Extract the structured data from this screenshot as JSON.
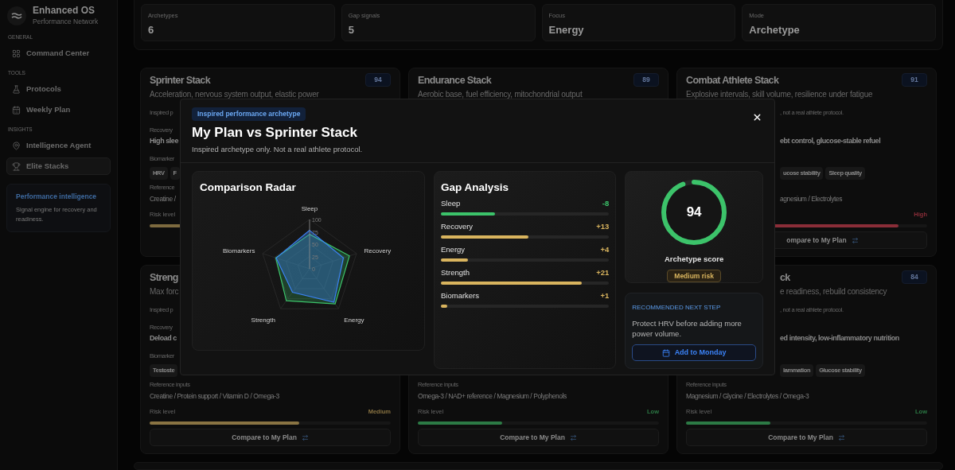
{
  "sidebar": {
    "brand": {
      "name": "Enhanced OS",
      "tagline": "Performance Network"
    },
    "sections": [
      {
        "label": "GENERAL",
        "items": [
          {
            "label": "Command Center",
            "selected": false
          }
        ]
      },
      {
        "label": "TOOLS",
        "items": [
          {
            "label": "Protocols",
            "selected": false
          },
          {
            "label": "Weekly Plan",
            "selected": false
          }
        ]
      },
      {
        "label": "INSIGHTS",
        "items": [
          {
            "label": "Intelligence Agent",
            "selected": false
          },
          {
            "label": "Elite Stacks",
            "selected": true
          }
        ]
      }
    ],
    "promo": {
      "title": "Performance intelligence",
      "text": "Signal engine for recovery and readiness."
    }
  },
  "stats": [
    {
      "label": "Archetypes",
      "value": "6"
    },
    {
      "label": "Gap signals",
      "value": "5"
    },
    {
      "label": "Focus",
      "value": "Energy"
    },
    {
      "label": "Mode",
      "value": "Archetype"
    }
  ],
  "cards": [
    {
      "title": "Sprinter Stack",
      "subtitle": "Acceleration, nervous system output, elastic power",
      "score": "94",
      "note": "Inspired p",
      "recovery_label": "Recovery",
      "recovery_value": "High slee",
      "biomarkers_label": "Biomarker",
      "chips": [
        "HRV",
        "F"
      ],
      "reference_label": "Reference",
      "reference_value": "Creatine /",
      "risk_label": "Risk level",
      "risk": {
        "color": "#7d6a3f"
      }
    },
    {
      "title": "Endurance Stack",
      "subtitle": "Aerobic base, fuel efficiency, mitochondrial output",
      "score": "89"
    },
    {
      "left_covered_body": true,
      "title": "Combat Athlete Stack",
      "subtitle": "Explosive intervals, skill volume, resilience under fatigue",
      "score": "91",
      "note": ", not a real athlete protocol.",
      "recovery_value": "ebt control, glucose-stable refuel",
      "chips": [
        "ucose stability",
        "Sleep quality"
      ],
      "reference_value": "agnesium / Electrolytes",
      "risk": {
        "label": "High",
        "color": "#8a2d38",
        "level": 0.88
      },
      "button": {
        "label": "ompare to My Plan"
      }
    },
    {
      "title": "Streng",
      "subtitle": "Max forc",
      "note": "Inspired p",
      "recovery_label": "Recovery",
      "recovery_value": "Deload c",
      "biomarkers_label": "Biomarker",
      "chips": [
        "Testoste"
      ],
      "reference_label": "Reference inputs",
      "reference_value": "Creatine / Protein support / Vitamin D / Omega-3",
      "risk_label": "Risk level",
      "risk": {
        "label": "Medium",
        "color": "#8a7443",
        "level": 0.62
      },
      "button": {
        "label": "Compare to My Plan"
      }
    },
    {
      "reference_label": "Reference inputs",
      "reference_value": "Omega-3 / NAD+ reference / Magnesium / Polyphenols",
      "risk_label": "Risk level",
      "risk": {
        "label": "Low",
        "color": "#2c7a45",
        "level": 0.35
      },
      "button": {
        "label": "Compare to My Plan"
      }
    },
    {
      "left_covered_top": true,
      "title": "ck",
      "subtitle": "e readiness, rebuild consistency",
      "score": "84",
      "note": ", not a real athlete protocol.",
      "recovery_value": "ed intensity, low-inflammatory nutrition",
      "chips": [
        "lammation",
        "Glucose stability"
      ],
      "reference_label": "Reference inputs",
      "reference_value": "Magnesium / Glycine / Electrolytes / Omega-3",
      "risk_label": "Risk level",
      "risk": {
        "label": "Low",
        "color": "#2c7a45",
        "level": 0.35
      },
      "button": {
        "label": "Compare to My Plan"
      }
    }
  ],
  "modal": {
    "tag": "Inspired performance archetype",
    "title": "My Plan vs Sprinter Stack",
    "subtitle": "Inspired archetype only. Not a real athlete protocol.",
    "radar": {
      "title": "Comparison Radar",
      "chart_data": {
        "type": "radar",
        "categories": [
          "Sleep",
          "Recovery",
          "Energy",
          "Strength",
          "Biomarkers"
        ],
        "ylim": [
          0,
          100
        ],
        "yticks": [
          0,
          25,
          50,
          75,
          100
        ],
        "series": [
          {
            "color": "#3cc36a",
            "values": [
              70,
              85,
              88,
              80,
              72
            ]
          },
          {
            "color": "#3b82f6",
            "values": [
              78,
              72,
              84,
              59,
              71
            ]
          }
        ]
      }
    },
    "gap": {
      "title": "Gap Analysis",
      "rows": [
        {
          "label": "Sleep",
          "value": "-8",
          "level": 0.32,
          "color": "#3cc36a"
        },
        {
          "label": "Recovery",
          "value": "+13",
          "level": 0.52,
          "color": "#d9b45e"
        },
        {
          "label": "Energy",
          "value": "+4",
          "level": 0.16,
          "color": "#d9b45e"
        },
        {
          "label": "Strength",
          "value": "+21",
          "level": 0.84,
          "color": "#d9b45e"
        },
        {
          "label": "Biomarkers",
          "value": "+1",
          "level": 0.04,
          "color": "#d9b45e"
        }
      ]
    },
    "score": {
      "value": "94",
      "level": 0.94,
      "label": "Archetype score",
      "risk": "Medium risk"
    },
    "next_step": {
      "heading": "RECOMMENDED NEXT STEP",
      "text": "Protect HRV before adding more power volume.",
      "button": "Add to Monday"
    }
  }
}
